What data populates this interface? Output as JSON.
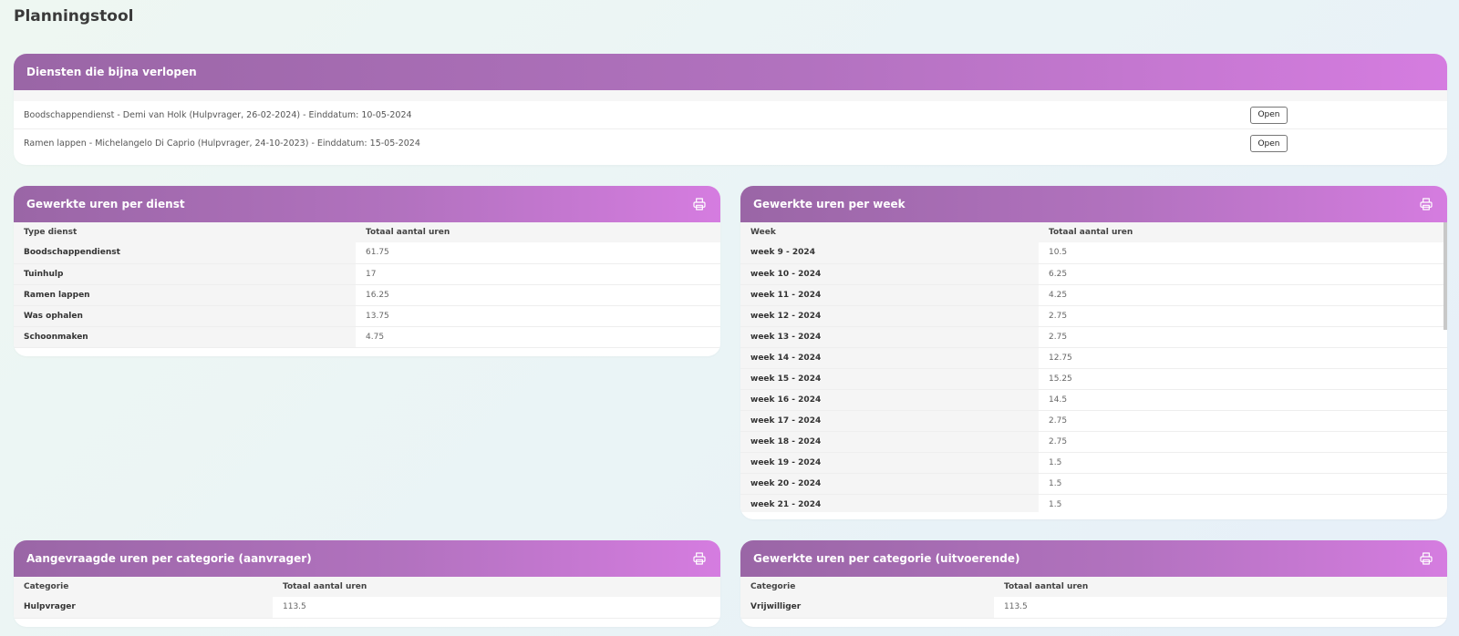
{
  "page": {
    "title": "Planningstool"
  },
  "expiring": {
    "title": "Diensten die bijna verlopen",
    "items": [
      {
        "text": "Boodschappendienst - Demi van Holk (Hulpvrager, 26-02-2024) - Einddatum: 10-05-2024",
        "button": "Open"
      },
      {
        "text": "Ramen lappen - Michelangelo Di Caprio (Hulpvrager, 24-10-2023) - Einddatum: 15-05-2024",
        "button": "Open"
      }
    ]
  },
  "per_dienst": {
    "title": "Gewerkte uren per dienst",
    "icon": "print-icon",
    "columns": [
      "Type dienst",
      "Totaal aantal uren"
    ],
    "rows": [
      [
        "Boodschappendienst",
        "61.75"
      ],
      [
        "Tuinhulp",
        "17"
      ],
      [
        "Ramen lappen",
        "16.25"
      ],
      [
        "Was ophalen",
        "13.75"
      ],
      [
        "Schoonmaken",
        "4.75"
      ]
    ]
  },
  "per_week": {
    "title": "Gewerkte uren per week",
    "icon": "print-icon",
    "columns": [
      "Week",
      "Totaal aantal uren"
    ],
    "rows": [
      [
        "week 9 - 2024",
        "10.5"
      ],
      [
        "week 10 - 2024",
        "6.25"
      ],
      [
        "week 11 - 2024",
        "4.25"
      ],
      [
        "week 12 - 2024",
        "2.75"
      ],
      [
        "week 13 - 2024",
        "2.75"
      ],
      [
        "week 14 - 2024",
        "12.75"
      ],
      [
        "week 15 - 2024",
        "15.25"
      ],
      [
        "week 16 - 2024",
        "14.5"
      ],
      [
        "week 17 - 2024",
        "2.75"
      ],
      [
        "week 18 - 2024",
        "2.75"
      ],
      [
        "week 19 - 2024",
        "1.5"
      ],
      [
        "week 20 - 2024",
        "1.5"
      ],
      [
        "week 21 - 2024",
        "1.5"
      ]
    ]
  },
  "aanvrager": {
    "title": "Aangevraagde uren per categorie (aanvrager)",
    "icon": "print-icon",
    "columns": [
      "Categorie",
      "Totaal aantal uren"
    ],
    "rows": [
      [
        "Hulpvrager",
        "113.5"
      ]
    ]
  },
  "uitvoerende": {
    "title": "Gewerkte uren per categorie (uitvoerende)",
    "icon": "print-icon",
    "columns": [
      "Categorie",
      "Totaal aantal uren"
    ],
    "rows": [
      [
        "Vrijwilliger",
        "113.5"
      ]
    ]
  },
  "colors": {
    "header_start": "#9a66a6",
    "header_end": "#d57ce0"
  }
}
